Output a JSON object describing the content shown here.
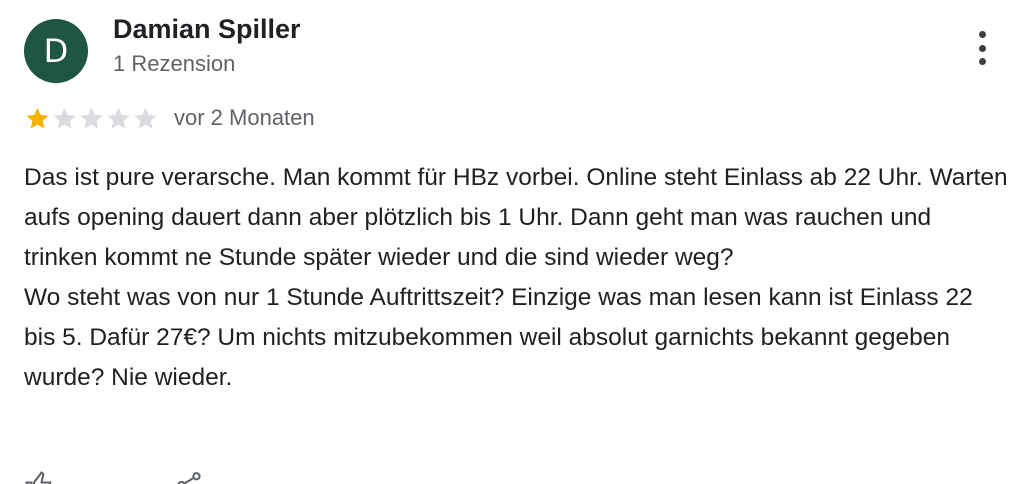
{
  "author": {
    "initial": "D",
    "name": "Damian Spiller",
    "meta": "1 Rezension",
    "avatar_color": "#1e5641"
  },
  "more_options_icon": "more-vertical-icon",
  "rating": {
    "value": 1,
    "max": 5,
    "filled_color": "#f4b400",
    "empty_color": "#dadce0",
    "time": "vor 2 Monaten"
  },
  "review": {
    "text": "Das ist pure verarsche. Man kommt für HBz vorbei. Online steht Einlass ab 22 Uhr. Warten aufs opening dauert dann aber plötzlich bis 1 Uhr. Dann geht man was rauchen und trinken kommt ne Stunde später wieder und die sind wieder weg?\nWo steht was von nur 1 Stunde Auftrittszeit? Einzige was man lesen kann ist Einlass 22 bis 5. Dafür 27€? Um nichts mitzubekommen weil absolut garnichts bekannt gegeben wurde? Nie wieder."
  },
  "actions": {
    "like_icon": "thumbs-up-icon",
    "share_icon": "share-icon"
  }
}
